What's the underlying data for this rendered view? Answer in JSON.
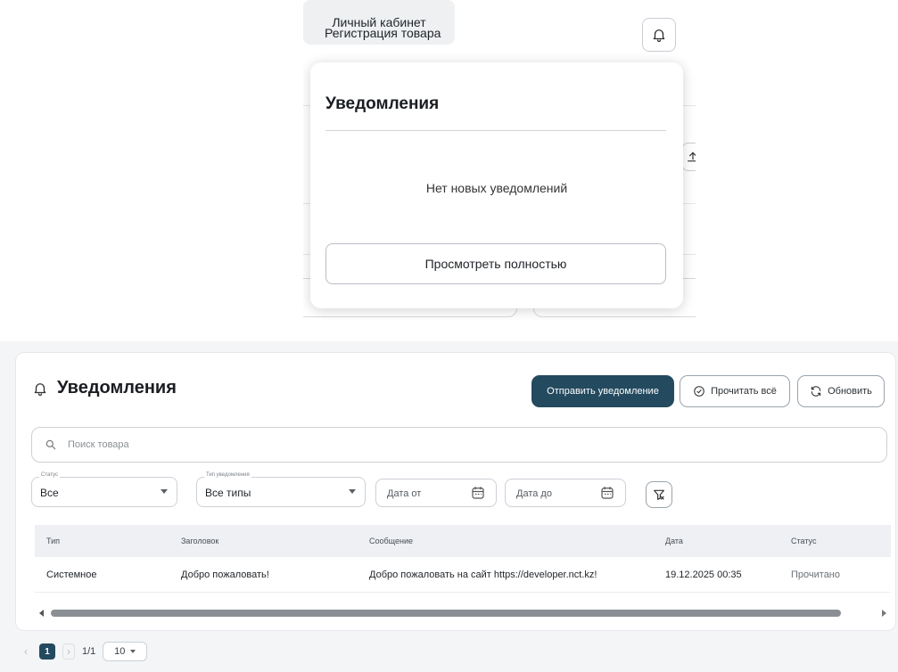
{
  "header": {
    "nav_register": "Регистрация товара",
    "nav_account": "Личный кабинет"
  },
  "notifications_dropdown": {
    "title": "Уведомления",
    "empty_text": "Нет новых уведомлений",
    "view_all_label": "Просмотреть полностью"
  },
  "page": {
    "title": "Уведомления",
    "buttons": {
      "send": "Отправить уведомление",
      "read_all": "Прочитать всё",
      "refresh": "Обновить"
    },
    "search": {
      "placeholder": "Поиск товара"
    },
    "filters": {
      "status": {
        "label": "Статус",
        "value": "Все"
      },
      "type": {
        "label": "Тип уведомления",
        "value": "Все типы"
      },
      "date_from": {
        "placeholder": "Дата от"
      },
      "date_to": {
        "placeholder": "Дата до"
      }
    },
    "table": {
      "headers": [
        "Тип",
        "Заголовок",
        "Сообщение",
        "Дата",
        "Статус"
      ],
      "rows": [
        [
          "Системное",
          "Добро пожаловать!",
          "Добро пожаловать на сайт https://developer.nct.kz!",
          "19.12.2025 00:35",
          "Прочитано"
        ]
      ]
    },
    "pagination": {
      "current_page": "1",
      "page_count": "1/1",
      "page_size": "10"
    }
  },
  "colors": {
    "primary": "#234a5f",
    "border": "#ccd1d6",
    "header_bg": "#eef0f3"
  }
}
